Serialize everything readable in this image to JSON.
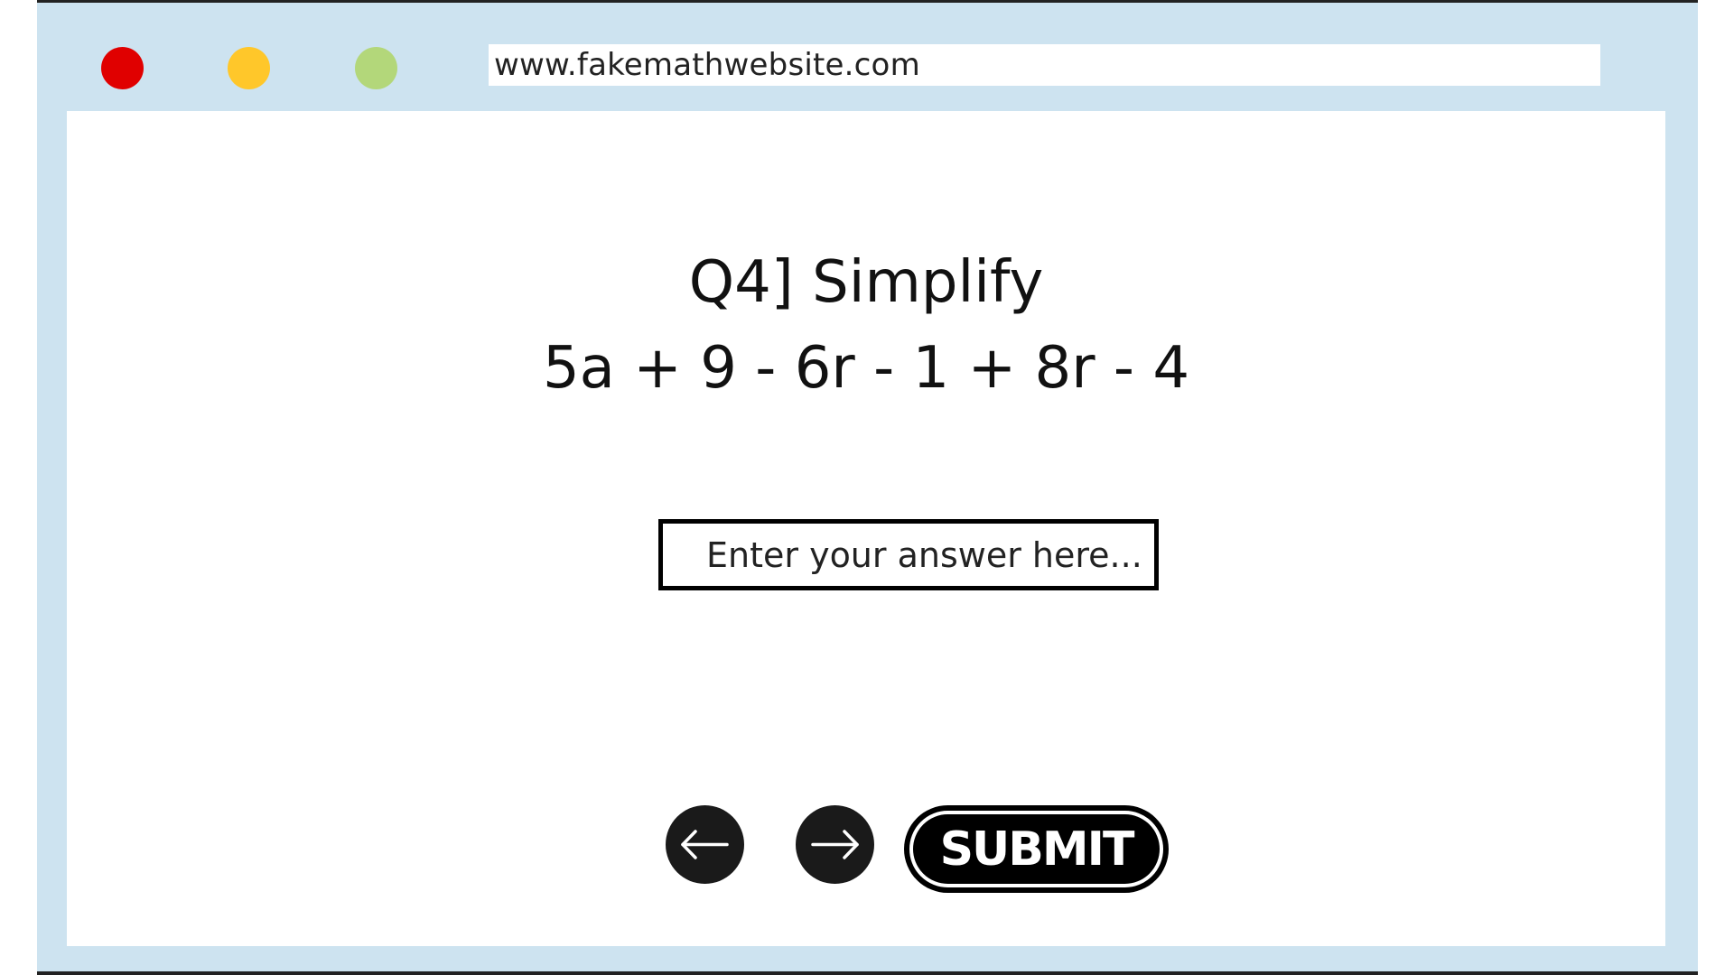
{
  "browser": {
    "url": "www.fakemathwebsite.com",
    "window_controls": [
      {
        "name": "close",
        "color": "#e00000"
      },
      {
        "name": "minimize",
        "color": "#ffc72a"
      },
      {
        "name": "maximize",
        "color": "#b3d77a"
      }
    ],
    "frame_color": "#cde3f0"
  },
  "question": {
    "title": "Q4] Simplify",
    "expression": "5a + 9 - 6r - 1 + 8r - 4"
  },
  "answer": {
    "placeholder": "Enter your answer here...",
    "value": ""
  },
  "controls": {
    "prev_icon": "arrow-left-icon",
    "next_icon": "arrow-right-icon",
    "submit_label": "SUBMIT"
  }
}
